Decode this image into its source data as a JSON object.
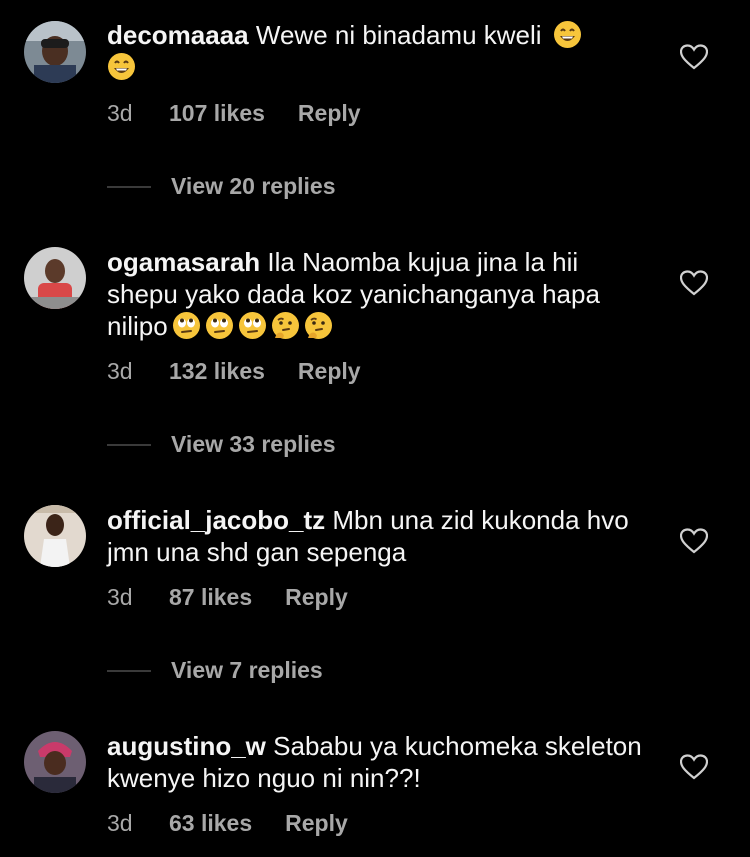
{
  "comments": [
    {
      "username": "decomaaaa",
      "text": "Wewe ni binadamu kweli",
      "emojis": [
        "grinning-face-emoji",
        "grinning-face-emoji"
      ],
      "time": "3d",
      "likes": "107 likes",
      "reply": "Reply",
      "view_replies": "View 20 replies"
    },
    {
      "username": "ogamasarah",
      "text": "Ila Naomba kujua jina la hii shepu yako dada koz yanichanganya hapa nilipo",
      "emojis": [
        "rolling-eyes-emoji",
        "rolling-eyes-emoji",
        "rolling-eyes-emoji",
        "thinking-face-emoji",
        "thinking-face-emoji"
      ],
      "time": "3d",
      "likes": "132 likes",
      "reply": "Reply",
      "view_replies": "View 33 replies"
    },
    {
      "username": "official_jacobo_tz",
      "text": "Mbn una zid kukonda hvo  jmn una shd gan sepenga",
      "emojis": [],
      "time": "3d",
      "likes": "87 likes",
      "reply": "Reply",
      "view_replies": "View 7 replies"
    },
    {
      "username": "augustino_w",
      "text": "Sababu ya kuchomeka skeleton kwenye hizo nguo ni nin??!",
      "emojis": [],
      "time": "3d",
      "likes": "63 likes",
      "reply": "Reply"
    }
  ],
  "colors": {
    "background": "#000000",
    "primary_text": "#f5f5f5",
    "secondary_text": "#a8a8a8",
    "divider": "#3a3a3a"
  },
  "icons": {
    "like": "heart-outline-icon"
  }
}
